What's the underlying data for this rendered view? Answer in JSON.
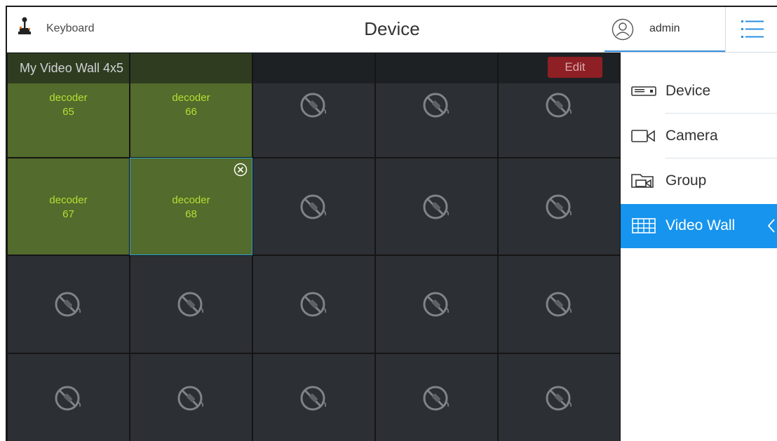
{
  "header": {
    "keyboard_label": "Keyboard",
    "title": "Device",
    "user_label": "admin"
  },
  "wall": {
    "name": "My Video Wall 4x5",
    "edit_label": "Edit",
    "rows": 4,
    "cols": 5,
    "cells": [
      {
        "row": 0,
        "col": 0,
        "assigned": true,
        "line1": "decoder",
        "line2": "65"
      },
      {
        "row": 0,
        "col": 1,
        "assigned": true,
        "line1": "decoder",
        "line2": "66"
      },
      {
        "row": 1,
        "col": 0,
        "assigned": true,
        "line1": "decoder",
        "line2": "67"
      },
      {
        "row": 1,
        "col": 1,
        "assigned": true,
        "line1": "decoder",
        "line2": "68",
        "selected": true
      }
    ]
  },
  "nav": {
    "items": [
      {
        "label": "Device",
        "icon": "device-icon"
      },
      {
        "label": "Camera",
        "icon": "camera-icon"
      },
      {
        "label": "Group",
        "icon": "group-icon"
      },
      {
        "label": "Video Wall",
        "icon": "video-wall-icon",
        "active": true
      }
    ]
  },
  "colors": {
    "accent": "#1694ee",
    "assigned_cell": "#536b2c",
    "decoder_text": "#b3e033",
    "edit_button": "#8e1f24"
  }
}
